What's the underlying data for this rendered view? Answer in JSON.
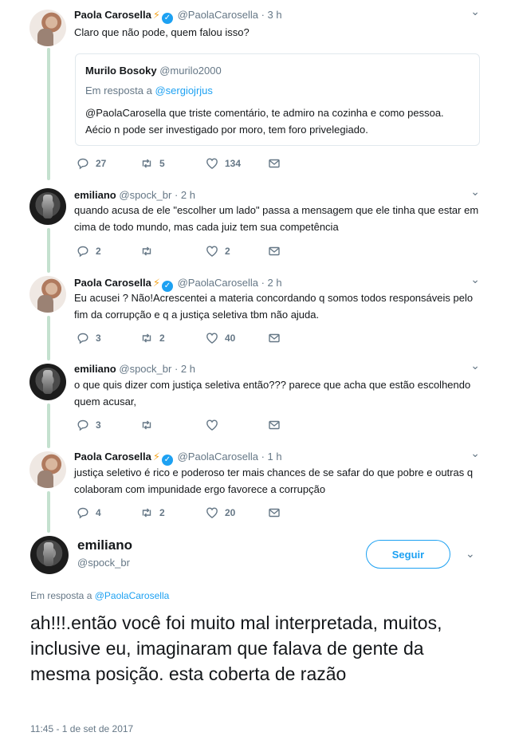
{
  "tweets": [
    {
      "name": "Paola Carosella",
      "handle": "@PaolaCarosella",
      "time": "3 h",
      "text": "Claro que não pode, quem falou isso?",
      "quote": {
        "name": "Murilo Bosoky",
        "handle": "@murilo2000",
        "reply_prefix": "Em resposta a",
        "reply_to": "@sergiojrjus",
        "text": "@PaolaCarosella que triste comentário, te admiro na cozinha e como pessoa. Aécio n pode ser investigado por moro, tem foro privelegiado."
      },
      "replies": "27",
      "retweets": "5",
      "likes": "134"
    },
    {
      "name": "emiliano",
      "handle": "@spock_br",
      "time": "2 h",
      "text": "quando acusa de ele \"escolher um lado\" passa a mensagem que ele tinha que estar em cima de todo mundo, mas cada juiz tem sua competência",
      "replies": "2",
      "retweets": "",
      "likes": "2"
    },
    {
      "name": "Paola Carosella",
      "handle": "@PaolaCarosella",
      "time": "2 h",
      "text": "Eu acusei ? Não!Acrescentei a materia concordando q somos todos responsáveis pelo fim da corrupção e q a justiça seletiva tbm não ajuda.",
      "replies": "3",
      "retweets": "2",
      "likes": "40"
    },
    {
      "name": "emiliano",
      "handle": "@spock_br",
      "time": "2 h",
      "text": "o que quis dizer com justiça seletiva então??? parece que  acha que estão escolhendo quem acusar,",
      "replies": "3",
      "retweets": "",
      "likes": ""
    },
    {
      "name": "Paola Carosella",
      "handle": "@PaolaCarosella",
      "time": "1 h",
      "text": "justiça seletivo é rico e poderoso ter mais chances de se safar do que pobre e outras q colaboram com impunidade ergo favorece a corrupção",
      "replies": "4",
      "retweets": "2",
      "likes": "20"
    }
  ],
  "main": {
    "name": "emiliano",
    "handle": "@spock_br",
    "follow_label": "Seguir",
    "reply_prefix": "Em resposta a",
    "reply_to": "@PaolaCarosella",
    "text": "ah!!!.então você foi muito mal interpretada, muitos, inclusive eu, imaginaram que falava de gente da mesma posição. esta coberta de razão",
    "timestamp": "11:45 - 1 de set de 2017"
  },
  "symbols": {
    "dot": "·",
    "chevron": "⌄",
    "verified": "✓",
    "bolt": "⚡"
  },
  "colors": {
    "accent": "#1da1f2",
    "muted": "#657786",
    "thread_line": "#c4e1cf",
    "bolt": "#f5a623"
  }
}
